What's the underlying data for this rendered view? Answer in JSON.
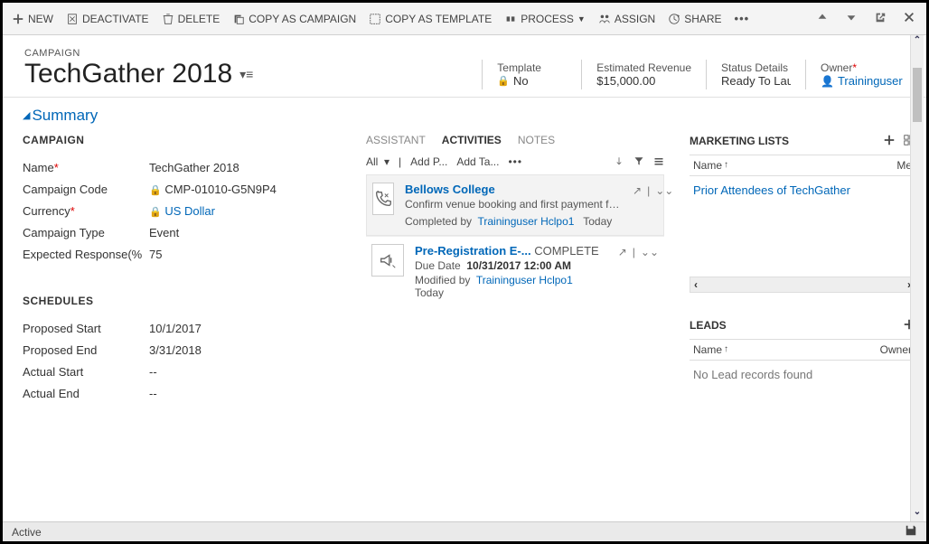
{
  "toolbar": {
    "new": "NEW",
    "deactivate": "DEACTIVATE",
    "delete": "DELETE",
    "copy_campaign": "COPY AS CAMPAIGN",
    "copy_template": "COPY AS TEMPLATE",
    "process": "PROCESS",
    "assign": "ASSIGN",
    "share": "SHARE"
  },
  "header": {
    "label": "CAMPAIGN",
    "title": "TechGather 2018",
    "template_lbl": "Template",
    "template_val": "No",
    "revenue_lbl": "Estimated Revenue",
    "revenue_val": "$15,000.00",
    "status_lbl": "Status Details",
    "status_val": "Ready To Launch",
    "owner_lbl": "Owner",
    "owner_val": "Traininguser"
  },
  "tab": "Summary",
  "campaign": {
    "section": "CAMPAIGN",
    "name_lbl": "Name",
    "name_val": "TechGather 2018",
    "code_lbl": "Campaign Code",
    "code_val": "CMP-01010-G5N9P4",
    "currency_lbl": "Currency",
    "currency_val": "US Dollar",
    "type_lbl": "Campaign Type",
    "type_val": "Event",
    "resp_lbl": "Expected Response(%",
    "resp_val": "75"
  },
  "schedules": {
    "section": "SCHEDULES",
    "pstart_lbl": "Proposed Start",
    "pstart_val": "10/1/2017",
    "pend_lbl": "Proposed End",
    "pend_val": "3/31/2018",
    "astart_lbl": "Actual Start",
    "astart_val": "--",
    "aend_lbl": "Actual End",
    "aend_val": "--"
  },
  "act": {
    "tab_assistant": "ASSISTANT",
    "tab_activities": "ACTIVITIES",
    "tab_notes": "NOTES",
    "all": "All",
    "add_p": "Add P...",
    "add_ta": "Add Ta...",
    "items": [
      {
        "title": "Bellows College",
        "desc": "Confirm venue booking and first payment for...",
        "done_by_lbl": "Completed by",
        "user": "Traininguser Hclpo1",
        "when": "Today"
      },
      {
        "title": "Pre-Registration E-...",
        "status": "COMPLETE",
        "due_lbl": "Due Date",
        "due_val": "10/31/2017 12:00 AM",
        "mod_by_lbl": "Modified by",
        "user": "Traininguser Hclpo1",
        "when": "Today"
      }
    ]
  },
  "ml": {
    "section": "MARKETING LISTS",
    "col_name": "Name",
    "col_me": "Me",
    "row": "Prior Attendees of TechGather"
  },
  "leads": {
    "section": "LEADS",
    "col_name": "Name",
    "col_owner": "Owner",
    "empty": "No Lead records found"
  },
  "footer": {
    "status": "Active"
  }
}
